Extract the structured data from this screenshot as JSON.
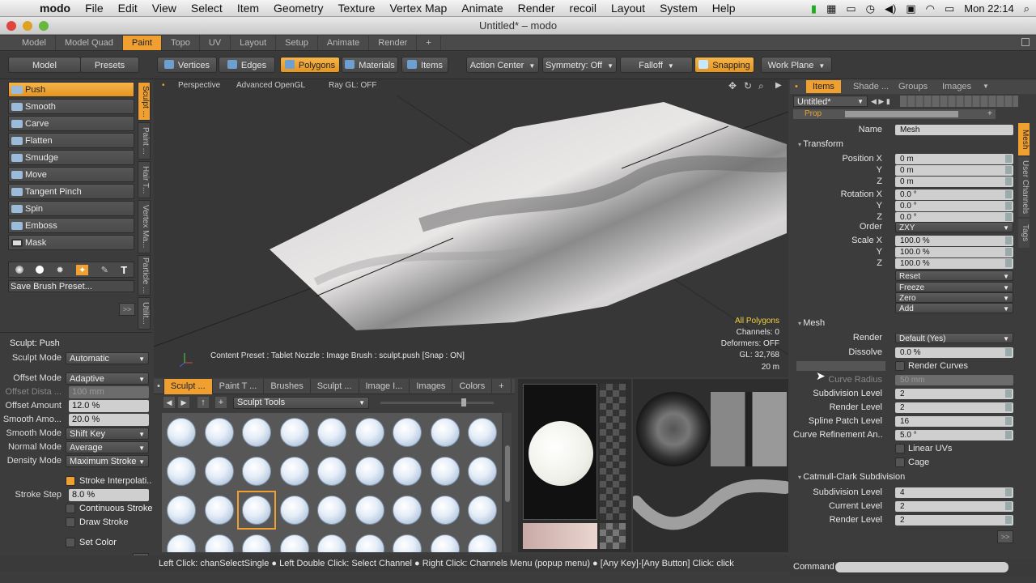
{
  "menubar": {
    "app": "modo",
    "items": [
      "File",
      "Edit",
      "View",
      "Select",
      "Item",
      "Geometry",
      "Texture",
      "Vertex Map",
      "Animate",
      "Render",
      "recoil",
      "Layout",
      "System",
      "Help"
    ],
    "clock": "Mon 22:14"
  },
  "window": {
    "title": "Untitled* – modo"
  },
  "layout_tabs": [
    "Model",
    "Model Quad",
    "Paint",
    "Topo",
    "UV",
    "Layout",
    "Setup",
    "Animate",
    "Render",
    "+"
  ],
  "toolbar": {
    "model": "Model",
    "presets": "Presets",
    "vertices": "Vertices",
    "edges": "Edges",
    "polygons": "Polygons",
    "materials": "Materials",
    "items": "Items",
    "action_center": "Action Center",
    "symmetry": "Symmetry: Off",
    "falloff": "Falloff",
    "snapping": "Snapping",
    "work_plane": "Work Plane"
  },
  "tools": [
    "Push",
    "Smooth",
    "Carve",
    "Flatten",
    "Smudge",
    "Move",
    "Tangent Pinch",
    "Spin",
    "Emboss",
    "Mask"
  ],
  "side_tabs": [
    "Sculpt ...",
    "Paint ...",
    "Hair T...",
    "Vertex Ma...",
    "Particle ...",
    "Utilit..."
  ],
  "save_brush": "Save Brush Preset...",
  "expand": ">>",
  "sculpt_props": {
    "title": "Sculpt: Push",
    "rows": [
      {
        "label": "Sculpt Mode",
        "value": "Automatic",
        "kind": "dd"
      },
      {
        "label": "Offset Mode",
        "value": "Adaptive",
        "kind": "dd"
      },
      {
        "label": "Offset Dista ...",
        "value": "100 mm",
        "kind": "dim"
      },
      {
        "label": "Offset Amount",
        "value": "12.0 %",
        "kind": "fld"
      },
      {
        "label": "Smooth Amo...",
        "value": "20.0 %",
        "kind": "fld"
      },
      {
        "label": "Smooth Mode",
        "value": "Shift Key",
        "kind": "dd"
      },
      {
        "label": "Normal Mode",
        "value": "Average",
        "kind": "dd"
      },
      {
        "label": "Density Mode",
        "value": "Maximum Stroke",
        "kind": "dd"
      }
    ],
    "stroke_interp": "Stroke Interpolati...",
    "stroke_step_label": "Stroke Step",
    "stroke_step": "8.0 %",
    "continuous": "Continuous Stroke",
    "draw_stroke": "Draw Stroke",
    "set_color": "Set Color"
  },
  "viewport": {
    "view": "Perspective",
    "shading": "Advanced OpenGL",
    "raygl": "Ray GL: OFF",
    "content_preset": "Content Preset : Tablet Nozzle : Image Brush : sculpt.push  [Snap : ON]",
    "info": [
      "All Polygons",
      "Channels: 0",
      "Deformers: OFF",
      "GL: 32,768",
      "20 m"
    ]
  },
  "bottom_tabs": [
    "Sculpt ...",
    "Paint T ...",
    "Brushes",
    "Sculpt ...",
    "Image I...",
    "Images",
    "Colors",
    "+"
  ],
  "sculpt_tools_dropdown": "Sculpt Tools",
  "right_tabs": [
    "Items",
    "Shade ...",
    "Groups",
    "Images"
  ],
  "item_list": {
    "selected": "Untitled*"
  },
  "properties": {
    "tab": "Prop",
    "name_label": "Name",
    "name": "Mesh",
    "transform": "Transform",
    "position": [
      {
        "label": "Position X",
        "value": "0 m"
      },
      {
        "label": "Y",
        "value": "0 m"
      },
      {
        "label": "Z",
        "value": "0 m"
      }
    ],
    "rotation": [
      {
        "label": "Rotation X",
        "value": "0.0 °"
      },
      {
        "label": "Y",
        "value": "0.0 °"
      },
      {
        "label": "Z",
        "value": "0.0 °"
      }
    ],
    "order_label": "Order",
    "order": "ZXY",
    "scale": [
      {
        "label": "Scale X",
        "value": "100.0 %"
      },
      {
        "label": "Y",
        "value": "100.0 %"
      },
      {
        "label": "Z",
        "value": "100.0 %"
      }
    ],
    "actions": [
      "Reset",
      "Freeze",
      "Zero",
      "Add"
    ],
    "mesh": "Mesh",
    "render_label": "Render",
    "render": "Default (Yes)",
    "dissolve_label": "Dissolve",
    "dissolve": "0.0 %",
    "render_curves": "Render Curves",
    "curve_radius_label": "Curve Radius",
    "curve_radius": "50 mm",
    "subdiv_label": "Subdivision Level",
    "subdiv": "2",
    "render_level_label": "Render Level",
    "render_level": "2",
    "spline_label": "Spline Patch Level",
    "spline": "16",
    "curve_ref_label": "Curve Refinement An...",
    "curve_ref": "5.0 °",
    "linear_uvs": "Linear UVs",
    "cage": "Cage",
    "catmull": "Catmull-Clark Subdivision",
    "cc_subdiv_label": "Subdivision Level",
    "cc_subdiv": "4",
    "cc_current_label": "Current Level",
    "cc_current": "2",
    "cc_render_label": "Render Level",
    "cc_render": "2",
    "side_tabs": [
      "Mesh",
      "User Channels",
      "Tags"
    ]
  },
  "statusbar": "Left Click: chanSelectSingle ● Left Double Click: Select Channel ● Right Click: Channels Menu (popup menu) ● [Any Key]-[Any Button] Click: click",
  "command_label": "Command"
}
